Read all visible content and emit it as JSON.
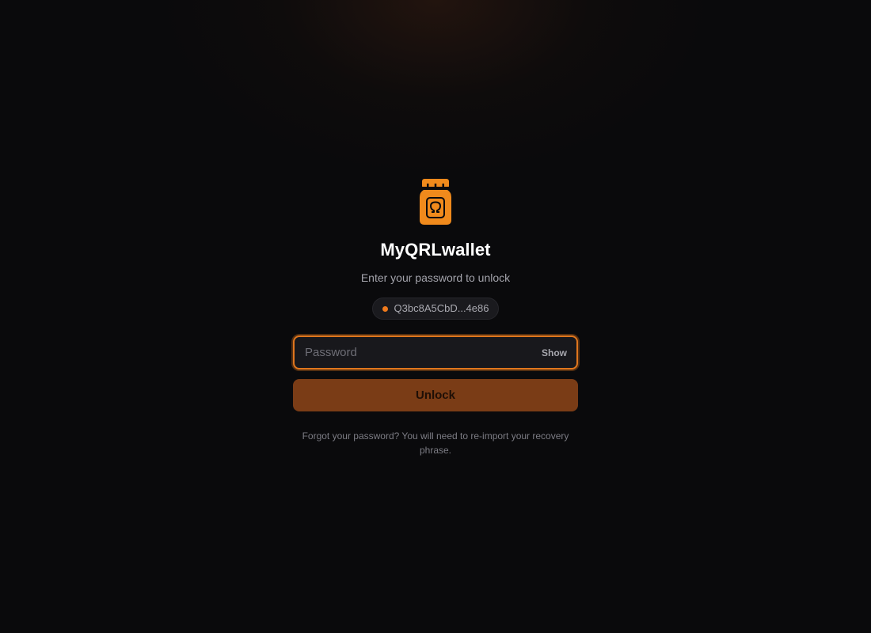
{
  "app": {
    "title": "MyQRLwallet",
    "subtitle": "Enter your password to unlock",
    "logo_icon": "wallet-jar-omega-icon"
  },
  "address": {
    "short": "Q3bc8A5CbD...4e86",
    "status_color": "#f07a1c"
  },
  "password": {
    "placeholder": "Password",
    "value": "",
    "toggle_label": "Show"
  },
  "actions": {
    "unlock_label": "Unlock"
  },
  "help": {
    "forgot_text": "Forgot your password? You will need to re-import your recovery phrase."
  },
  "colors": {
    "accent": "#f08a1c",
    "background": "#0a0a0c",
    "button_bg": "#7a3c16"
  }
}
